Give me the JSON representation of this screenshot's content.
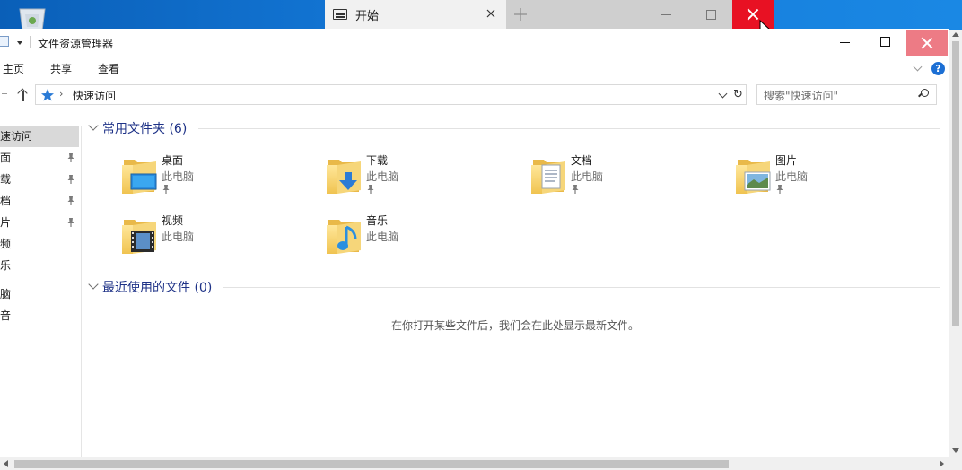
{
  "outer_window": {
    "tab_title": "开始",
    "tab_icon": "window-icon",
    "colors": {
      "close_bg": "#e81123",
      "tab_bg": "#f1f1f1",
      "strip_bg": "#cfcfcf"
    }
  },
  "explorer": {
    "title": "文件资源管理器",
    "ribbon_tabs": [
      "主页",
      "共享",
      "查看"
    ],
    "help_label": "?",
    "address": {
      "location": "快速访问",
      "location_icon": "star-icon"
    },
    "search_placeholder": "搜索\"快速访问\"",
    "nav_pane": {
      "items": [
        {
          "label": "速访问",
          "selected": true,
          "pinned": false
        },
        {
          "label": "面",
          "pinned": true
        },
        {
          "label": "载",
          "pinned": true
        },
        {
          "label": "档",
          "pinned": true
        },
        {
          "label": "片",
          "pinned": true
        },
        {
          "label": "频",
          "pinned": false
        },
        {
          "label": "乐",
          "pinned": false
        },
        {
          "label": "脑",
          "pinned": false
        },
        {
          "label": "音",
          "pinned": false
        }
      ]
    },
    "frequent": {
      "title": "常用文件夹 (6)",
      "folders": [
        {
          "name": "桌面",
          "location": "此电脑",
          "pinned": true,
          "icon": "desktop-folder-icon"
        },
        {
          "name": "下载",
          "location": "此电脑",
          "pinned": true,
          "icon": "downloads-folder-icon"
        },
        {
          "name": "文档",
          "location": "此电脑",
          "pinned": true,
          "icon": "documents-folder-icon"
        },
        {
          "name": "图片",
          "location": "此电脑",
          "pinned": true,
          "icon": "pictures-folder-icon"
        },
        {
          "name": "视频",
          "location": "此电脑",
          "pinned": false,
          "icon": "videos-folder-icon"
        },
        {
          "name": "音乐",
          "location": "此电脑",
          "pinned": false,
          "icon": "music-folder-icon"
        }
      ]
    },
    "recent": {
      "title": "最近使用的文件 (0)",
      "empty_message": "在你打开某些文件后，我们会在此处显示最新文件。"
    },
    "colors": {
      "section_title": "#1e3287",
      "selected_nav": "#d9d9d9",
      "close_hover": "#ed7b85",
      "help": "#1c6fd4"
    }
  }
}
